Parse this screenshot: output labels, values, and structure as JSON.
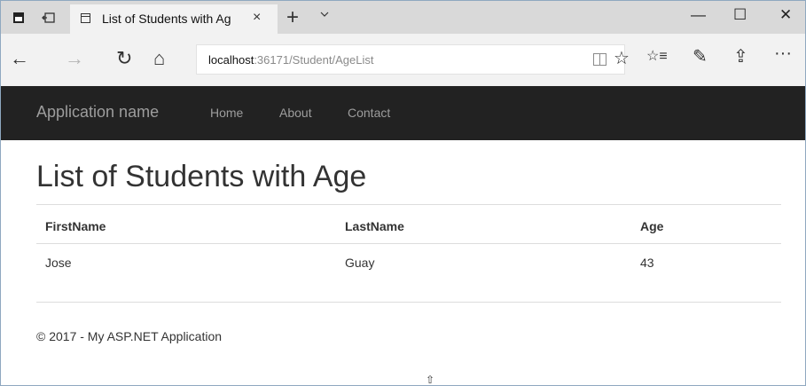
{
  "tab": {
    "title": "List of Students with Ag",
    "close": "×"
  },
  "newtab": "+",
  "window": {
    "minimize": "—",
    "maximize": "☐",
    "close": "✕"
  },
  "nav": {
    "back": "←",
    "forward": "→",
    "refresh": "↻",
    "home": "⌂"
  },
  "address": {
    "host": "localhost",
    "path": ":36171/Student/AgeList"
  },
  "toolbar": {
    "favorites": "☆",
    "hub": "☆≡",
    "notes": "✎",
    "share": "⇪",
    "more": "···"
  },
  "site": {
    "brand": "Application name",
    "links": [
      "Home",
      "About",
      "Contact"
    ]
  },
  "page": {
    "title": "List of Students with Age",
    "table": {
      "headers": [
        "FirstName",
        "LastName",
        "Age"
      ],
      "rows": [
        [
          "Jose",
          "Guay",
          "43"
        ]
      ]
    },
    "footer": "© 2017 - My ASP.NET Application"
  }
}
